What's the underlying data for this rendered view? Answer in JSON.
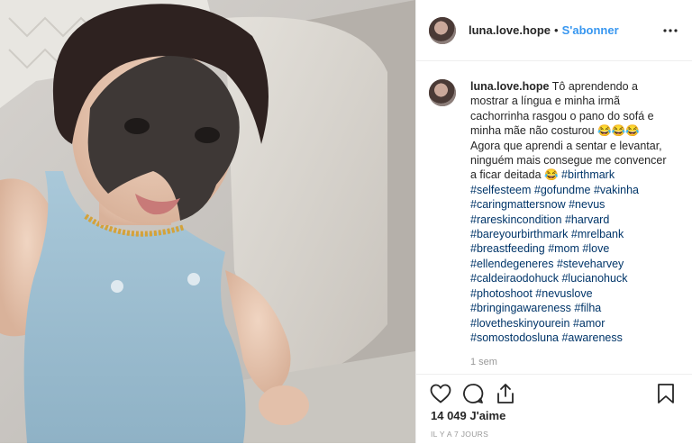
{
  "post": {
    "username": "luna.love.hope",
    "separator": "•",
    "follow_label": "S'abonner",
    "more_icon": "more-horizontal-icon"
  },
  "caption": {
    "username": "luna.love.hope",
    "text": "Tô aprendendo a mostrar a língua e minha irmã cachorrinha rasgou o pano do sofá e minha mãe não costurou 😂😂😂 Agora que aprendi a sentar e levantar, ninguém mais consegue me convencer a ficar deitada 😂",
    "hashtags": [
      "#birthmark",
      "#selfesteem",
      "#gofundme",
      "#vakinha",
      "#caringmattersnow",
      "#nevus",
      "#rareskincondition",
      "#harvard",
      "#bareyourbirthmark",
      "#mrelbank",
      "#breastfeeding",
      "#mom",
      "#love",
      "#ellendegeneres",
      "#steveharvey",
      "#caldeiraodohuck",
      "#lucianohuck",
      "#photoshoot",
      "#nevuslove",
      "#bringingawareness",
      "#filha",
      "#lovetheskinyourein",
      "#amor",
      "#somostodosluna",
      "#awareness"
    ],
    "age": "1 sem"
  },
  "actions": {
    "like_icon": "heart-icon",
    "comment_icon": "comment-icon",
    "share_icon": "share-icon",
    "save_icon": "bookmark-icon",
    "likes_text": "14 049 J'aime",
    "posted_when": "IL Y A 7 JOURS"
  },
  "colors": {
    "link": "#3897f0",
    "hashtag": "#003569",
    "muted": "#999999",
    "border": "#efefef"
  }
}
